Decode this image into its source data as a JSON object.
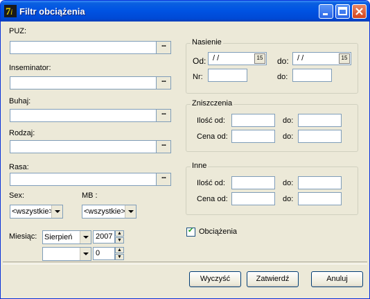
{
  "window": {
    "title": "Filtr obciążenia"
  },
  "left": {
    "puz_label": "PUZ:",
    "inseminator_label": "Inseminator:",
    "buhaj_label": "Buhaj:",
    "rodzaj_label": "Rodzaj:",
    "rasa_label": "Rasa:",
    "ellipsis": "...",
    "sex_label": "Sex:",
    "mb_label": "MB :",
    "sex_value": "<wszystkie>",
    "mb_value": "<wszystkie>",
    "miesiac_label": "Miesiąc:",
    "month_value": "Sierpień",
    "year_value": "2007",
    "month2_value": "",
    "num_value": "0"
  },
  "nasienie": {
    "title": "Nasienie",
    "od_label": "Od:",
    "do_label": "do:",
    "nr_label": "Nr:",
    "do2_label": "do:",
    "date_from": "/ /",
    "date_to": "/ /",
    "cal_icon": "15"
  },
  "zniszczenia": {
    "title": "Zniszczenia",
    "ilosc_label": "Ilość od:",
    "cena_label": "Cena od:",
    "do_label": "do:"
  },
  "inne": {
    "title": "Inne",
    "ilosc_label": "Ilość od:",
    "cena_label": "Cena od:",
    "do_label": "do:"
  },
  "checkbox": {
    "label": "Obciążenia",
    "checked": true
  },
  "buttons": {
    "clear": "Wyczyść",
    "ok": "Zatwierdź",
    "cancel": "Anuluj"
  }
}
